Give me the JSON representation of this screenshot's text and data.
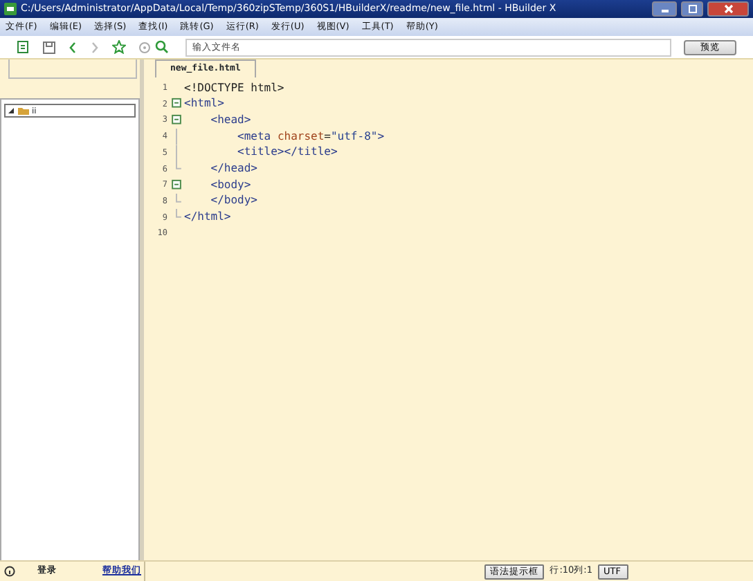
{
  "window": {
    "title": "C:/Users/Administrator/AppData/Local/Temp/360zipSTemp/360S1/HBuilderX/readme/new_file.html - HBuilder X"
  },
  "menu": [
    "文件(F)",
    "编辑(E)",
    "选择(S)",
    "查找(I)",
    "跳转(G)",
    "运行(R)",
    "发行(U)",
    "视图(V)",
    "工具(T)",
    "帮助(Y)"
  ],
  "toolbar": {
    "forward_disabled": true,
    "search": {
      "placeholder": "输入文件名"
    },
    "preview_button": "预览"
  },
  "sidebar": {
    "tree": [
      {
        "label": "ii",
        "selected": true
      }
    ]
  },
  "editor": {
    "tabs": [
      {
        "label": "new_file.html",
        "selected": true
      }
    ],
    "lines": [
      {
        "number": "1",
        "kind": "line",
        "tokens": [
          {
            "kind": "plain",
            "text": "<!DOCTYPE html>"
          }
        ]
      },
      {
        "number": "2",
        "kind": "line",
        "expanded": true,
        "tokens": [
          {
            "kind": "tag",
            "text": "<html>"
          }
        ],
        "children": [
          {
            "number": "3",
            "kind": "line",
            "expanded": true,
            "tokens": [
              {
                "kind": "tag",
                "text": "<head>"
              }
            ],
            "children": [
              {
                "number": "4",
                "kind": "line",
                "tokens": [
                  {
                    "kind": "tag",
                    "text": "<meta "
                  },
                  {
                    "kind": "attr",
                    "text": "charset"
                  },
                  {
                    "kind": "plain",
                    "text": "="
                  },
                  {
                    "kind": "string",
                    "text": "\"utf-8\""
                  },
                  {
                    "kind": "tag",
                    "text": ">"
                  }
                ]
              },
              {
                "number": "5",
                "kind": "line",
                "tokens": [
                  {
                    "kind": "tag",
                    "text": "<title></title>"
                  }
                ]
              },
              {
                "number": "6",
                "kind": "close",
                "tokens": [
                  {
                    "kind": "tag",
                    "text": "</head>"
                  }
                ]
              }
            ]
          },
          {
            "number": "7",
            "kind": "line",
            "expanded": true,
            "tokens": [
              {
                "kind": "tag",
                "text": "<body>"
              }
            ],
            "children": [
              {
                "number": "8",
                "kind": "close",
                "tokens": [
                  {
                    "kind": "tag",
                    "text": "</body>"
                  }
                ]
              }
            ]
          },
          {
            "number": "9",
            "kind": "close",
            "tokens": [
              {
                "kind": "tag",
                "text": "</html>"
              }
            ]
          }
        ]
      },
      {
        "number": "10",
        "kind": "line"
      }
    ]
  },
  "status_bar": {
    "login": "登录",
    "help_link": "帮助我们",
    "syntax_button": "语法提示框",
    "position": "行:10列:1",
    "encoding_button": "UTF"
  }
}
